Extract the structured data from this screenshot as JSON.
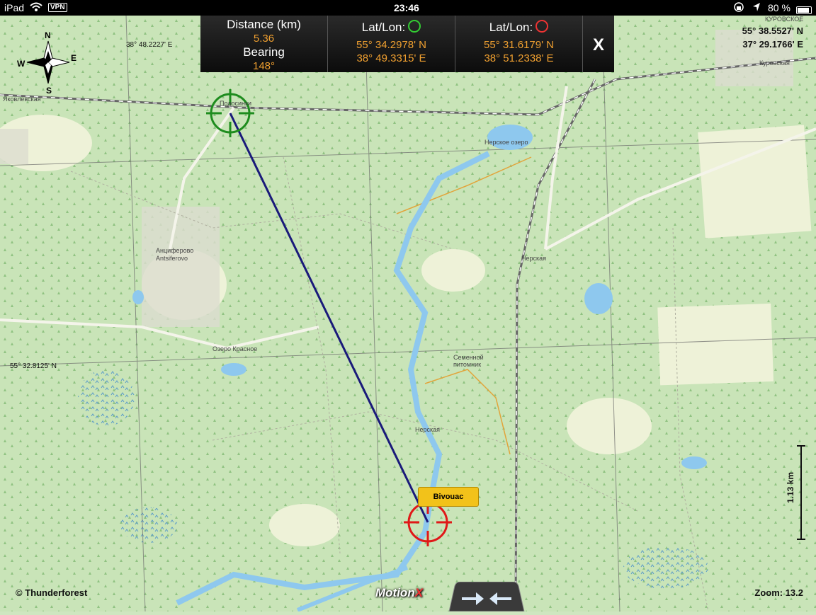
{
  "status_bar": {
    "device": "iPad",
    "vpn": "VPN",
    "time": "23:46",
    "battery": "80 %"
  },
  "info_bar": {
    "distance_title": "Distance (km)",
    "distance_value": "5.36",
    "bearing_title": "Bearing",
    "bearing_value": "148°",
    "start_title": "Lat/Lon:",
    "start_lat": "55° 34.2978' N",
    "start_lon": "38° 49.3315' E",
    "end_title": "Lat/Lon:",
    "end_lat": "55° 31.6179' N",
    "end_lon": "38° 51.2338' E",
    "close_label": "X"
  },
  "current_position": {
    "lat": "55° 38.5527' N",
    "lon": "37° 29.1766' E"
  },
  "compass": {
    "n": "N",
    "s": "S",
    "e": "E",
    "w": "W"
  },
  "grid_labels": {
    "lon_top": "38° 48.2227' E",
    "lat_mid": "55° 32.8125' N"
  },
  "map_labels": {
    "podosinki": "Подосинки",
    "yakovlevskaya": "Яковлевская",
    "antsiferovo_ru": "Анциферово",
    "antsiferovo_en": "Antsiferovo",
    "nerskoe_ozero": "Нерское озеро",
    "nerskaya_station": "Нерская",
    "nerskaya_river": "Нерская",
    "ozero_krasnoe": "Озеро Красное",
    "pitomnik": "Семенной питомник",
    "kurovskaya": "Куровская",
    "kurovskoe": "КУРОВСКОЕ"
  },
  "marker": {
    "label": "Bivouac"
  },
  "scale_bar": {
    "label": "1.13 km"
  },
  "attribution": "© Thunderforest",
  "zoom": "Zoom: 13.2",
  "logo": {
    "text": "Motion",
    "x": "X"
  },
  "colors": {
    "route_line": "#1a1a7a",
    "start_marker": "#1e8c1e",
    "end_marker": "#e01818",
    "value_orange": "#f0a030",
    "map_green": "#cfe6c0",
    "water": "#8ec8ee",
    "marker_yellow": "#f2c21a"
  },
  "icons": {
    "start_target": "green-crosshair-icon",
    "end_target": "red-crosshair-icon",
    "wifi": "wifi-icon",
    "location": "location-arrow-icon",
    "lock": "rotation-lock-icon",
    "battery": "battery-icon",
    "compass": "compass-rose-icon",
    "nav_arrows": "swap-arrows-icon"
  }
}
